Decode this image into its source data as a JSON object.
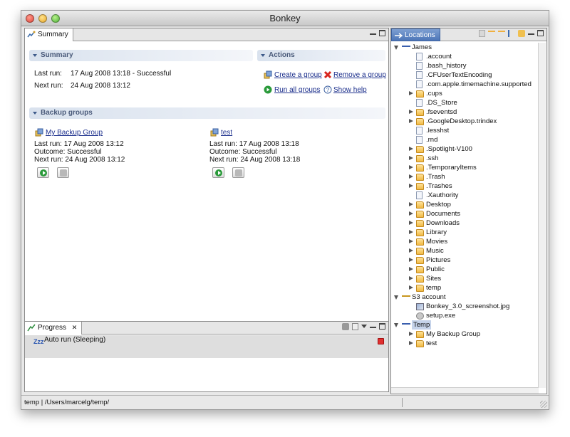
{
  "window": {
    "title": "Bonkey"
  },
  "summary": {
    "tab_label": "Summary",
    "section_summary": "Summary",
    "section_actions": "Actions",
    "last_run_label": "Last run:",
    "last_run_value": "17 Aug 2008 13:18 - Successful",
    "next_run_label": "Next run:",
    "next_run_value": "24 Aug 2008 13:12",
    "actions": {
      "create_group": "Create a group",
      "remove_group": "Remove a group",
      "run_all": "Run all groups",
      "show_help": "Show help"
    },
    "section_backup_groups": "Backup groups",
    "groups": [
      {
        "name": "My Backup Group",
        "last_run": "Last run: 17 Aug 2008 13:12",
        "outcome": "Outcome: Successful",
        "next_run": "Next run: 24 Aug 2008 13:12"
      },
      {
        "name": "test",
        "last_run": "Last run: 17 Aug 2008 13:18",
        "outcome": "Outcome: Successful",
        "next_run": "Next run: 24 Aug 2008 13:18"
      }
    ]
  },
  "progress": {
    "tab_label": "Progress",
    "icon_text": "Zzz",
    "job": "Auto run (Sleeping)"
  },
  "locations": {
    "tab_label": "Locations",
    "tree": [
      {
        "label": "James",
        "type": "conn",
        "level": 0,
        "state": "open"
      },
      {
        "label": ".account",
        "type": "file",
        "level": 1,
        "state": "none"
      },
      {
        "label": ".bash_history",
        "type": "file",
        "level": 1,
        "state": "none"
      },
      {
        "label": ".CFUserTextEncoding",
        "type": "file",
        "level": 1,
        "state": "none"
      },
      {
        "label": ".com.apple.timemachine.supported",
        "type": "file",
        "level": 1,
        "state": "none"
      },
      {
        "label": ".cups",
        "type": "folder",
        "level": 1,
        "state": "closed"
      },
      {
        "label": ".DS_Store",
        "type": "file",
        "level": 1,
        "state": "none"
      },
      {
        "label": ".fseventsd",
        "type": "folder",
        "level": 1,
        "state": "closed"
      },
      {
        "label": ".GoogleDesktop.trindex",
        "type": "folder",
        "level": 1,
        "state": "closed"
      },
      {
        "label": ".lesshst",
        "type": "file",
        "level": 1,
        "state": "none"
      },
      {
        "label": ".rnd",
        "type": "file",
        "level": 1,
        "state": "none"
      },
      {
        "label": ".Spotlight-V100",
        "type": "folder",
        "level": 1,
        "state": "closed"
      },
      {
        "label": ".ssh",
        "type": "folder",
        "level": 1,
        "state": "closed"
      },
      {
        "label": ".TemporaryItems",
        "type": "folder",
        "level": 1,
        "state": "closed"
      },
      {
        "label": ".Trash",
        "type": "folder",
        "level": 1,
        "state": "closed"
      },
      {
        "label": ".Trashes",
        "type": "folder",
        "level": 1,
        "state": "closed"
      },
      {
        "label": ".Xauthority",
        "type": "file",
        "level": 1,
        "state": "none"
      },
      {
        "label": "Desktop",
        "type": "folder",
        "level": 1,
        "state": "closed"
      },
      {
        "label": "Documents",
        "type": "folder",
        "level": 1,
        "state": "closed"
      },
      {
        "label": "Downloads",
        "type": "folder",
        "level": 1,
        "state": "closed"
      },
      {
        "label": "Library",
        "type": "folder",
        "level": 1,
        "state": "closed"
      },
      {
        "label": "Movies",
        "type": "folder",
        "level": 1,
        "state": "closed"
      },
      {
        "label": "Music",
        "type": "folder",
        "level": 1,
        "state": "closed"
      },
      {
        "label": "Pictures",
        "type": "folder",
        "level": 1,
        "state": "closed"
      },
      {
        "label": "Public",
        "type": "folder",
        "level": 1,
        "state": "closed"
      },
      {
        "label": "Sites",
        "type": "folder",
        "level": 1,
        "state": "closed"
      },
      {
        "label": "temp",
        "type": "folder",
        "level": 1,
        "state": "closed"
      },
      {
        "label": "S3 account",
        "type": "key",
        "level": 0,
        "state": "open"
      },
      {
        "label": "Bonkey_3.0_screenshot.jpg",
        "type": "img",
        "level": 1,
        "state": "none"
      },
      {
        "label": "setup.exe",
        "type": "exe",
        "level": 1,
        "state": "none"
      },
      {
        "label": "Temp",
        "type": "conn",
        "level": 0,
        "state": "open",
        "selected": true
      },
      {
        "label": "My Backup Group",
        "type": "folder",
        "level": 1,
        "state": "closed"
      },
      {
        "label": "test",
        "type": "folder",
        "level": 1,
        "state": "closed"
      }
    ]
  },
  "statusbar": {
    "path": "temp | /Users/marcelg/temp/"
  },
  "icons": {
    "summary_tab": "summary-icon",
    "create": "create-group-icon",
    "remove": "remove-icon",
    "run": "run-icon",
    "help": "help-icon",
    "group": "backup-group-icon",
    "progress_tab": "progress-icon",
    "stop": "stop-icon"
  },
  "colors": {
    "accent": "#4d76b8",
    "link": "#1c2f8c",
    "remove": "#d8261e",
    "run": "#2a9a3a"
  }
}
